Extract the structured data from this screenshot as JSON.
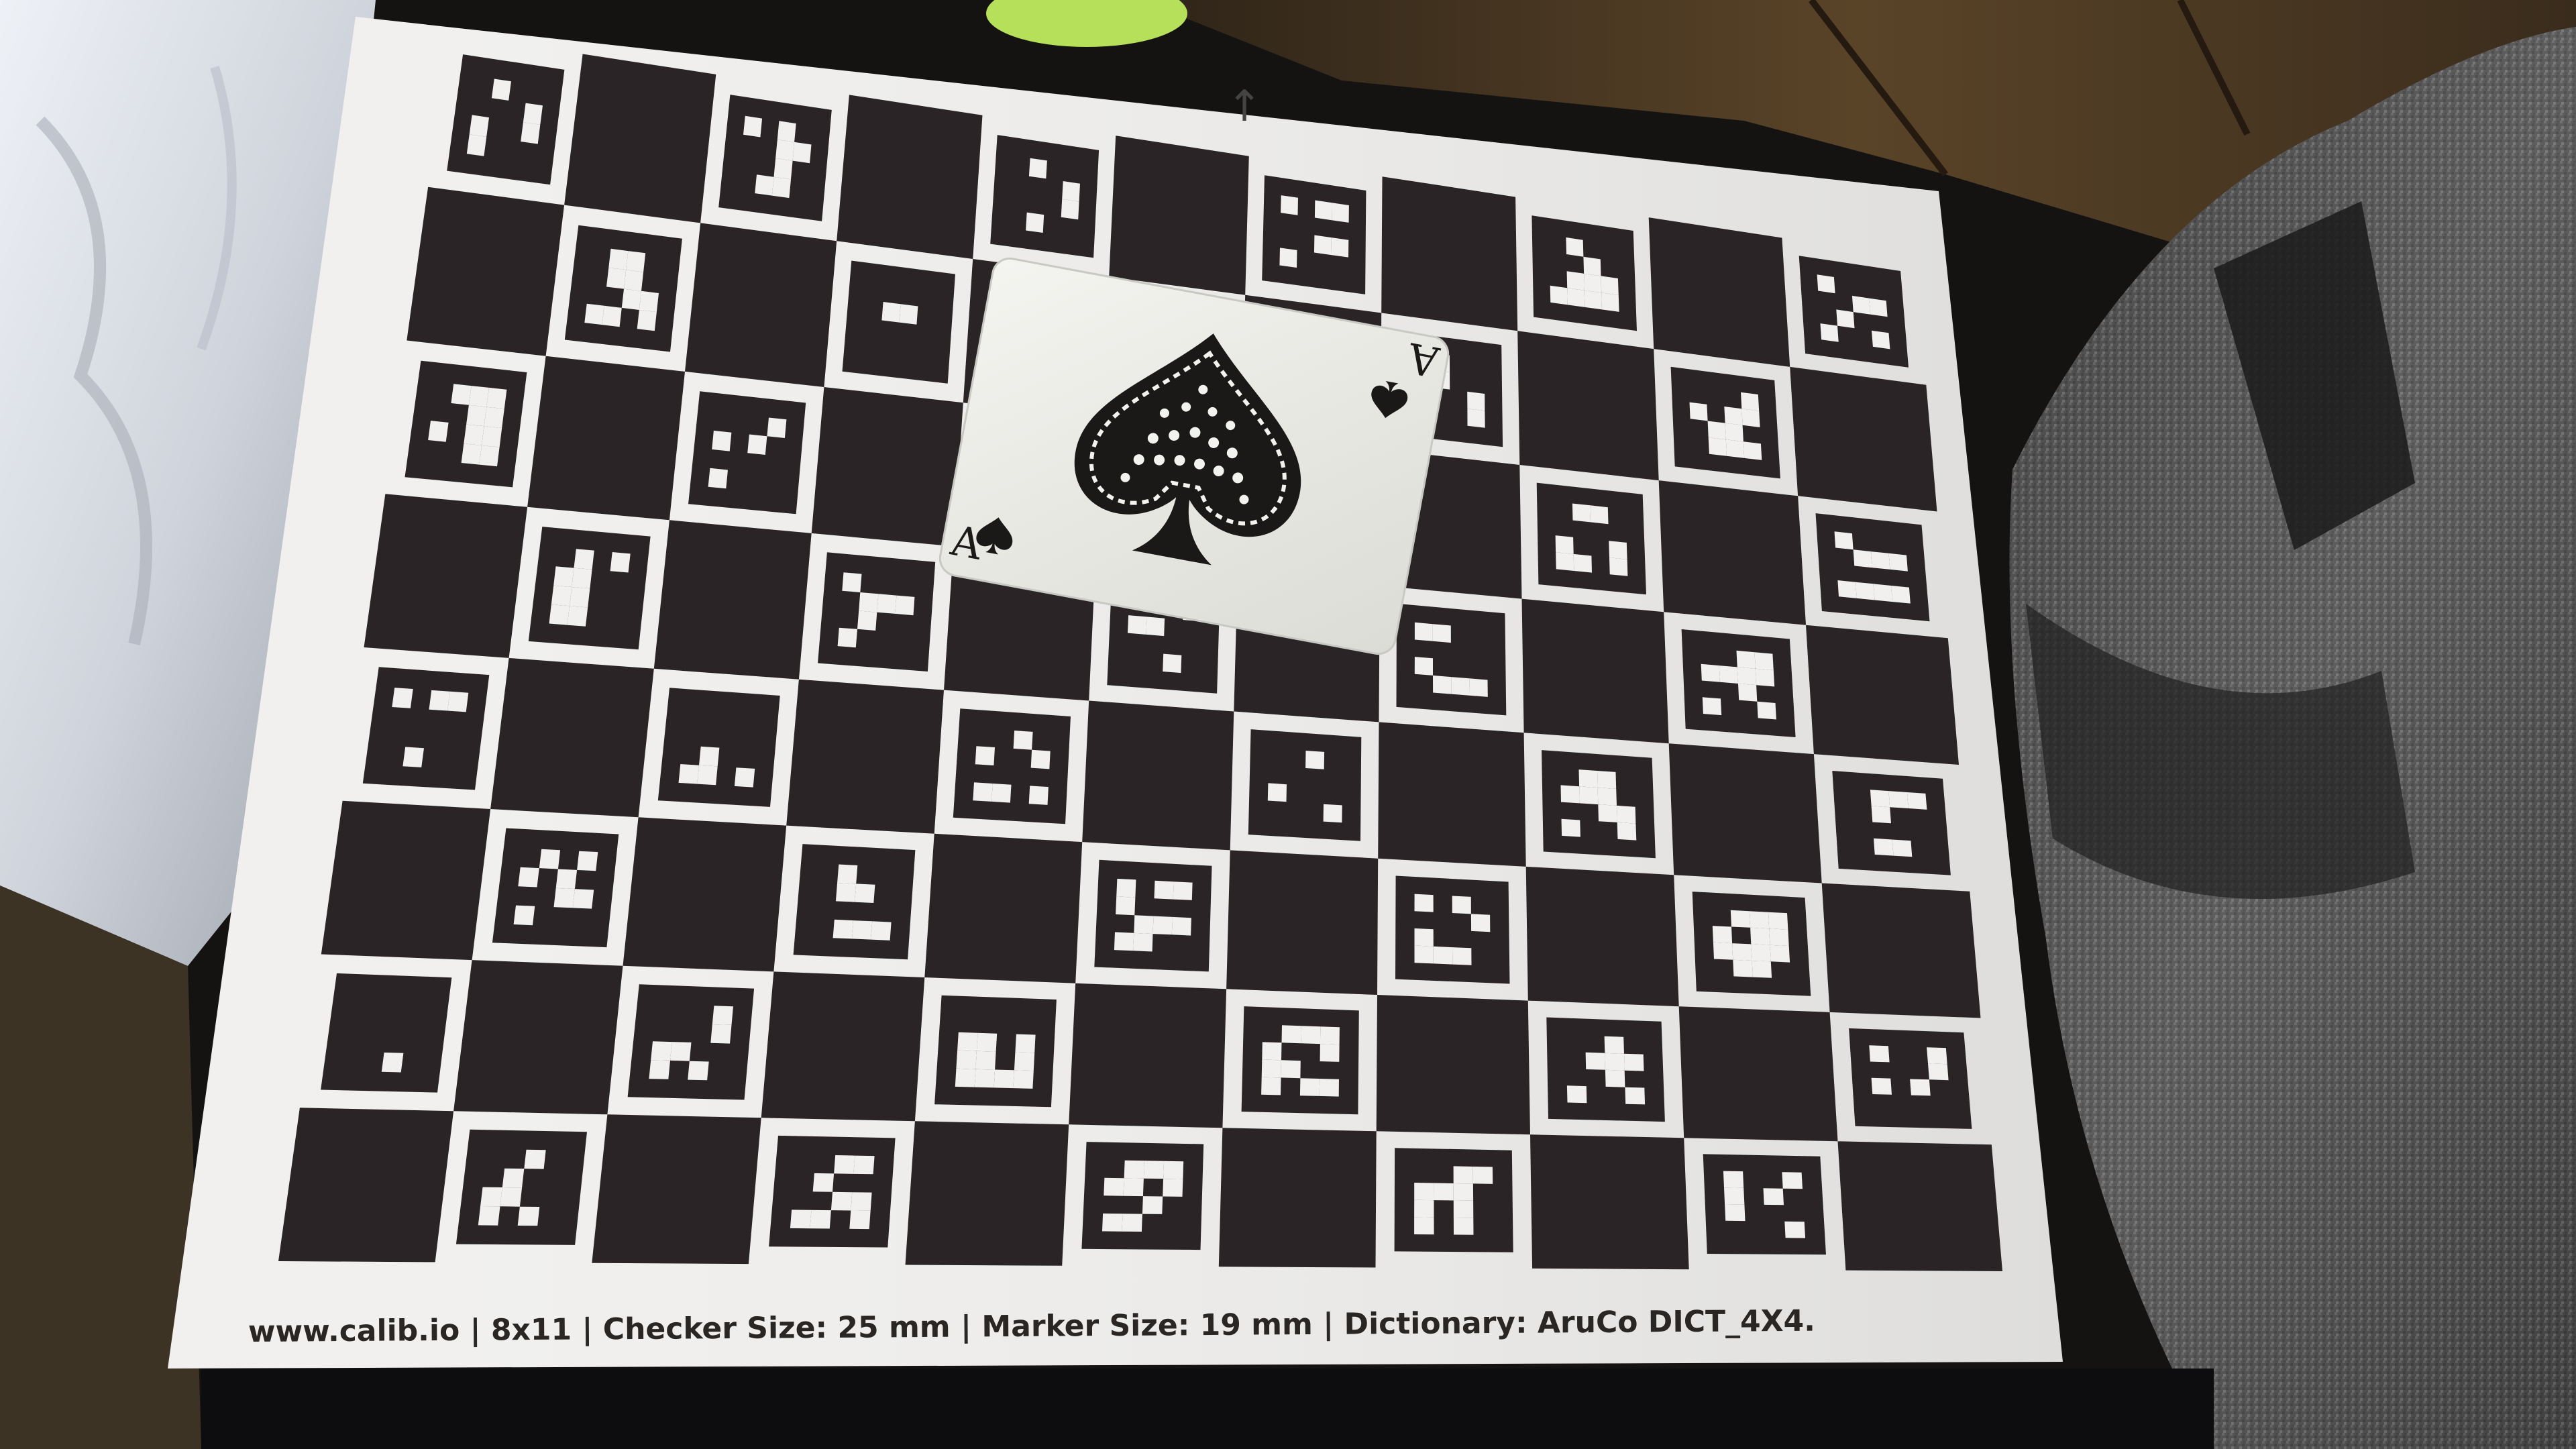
{
  "board": {
    "footer_text": "www.calib.io | 8x11 | Checker Size: 25 mm | Marker Size: 19 mm | Dictionary: AruCo DICT_4X4.",
    "rows": 8,
    "cols": 11,
    "orientation_mark": "↑"
  },
  "card": {
    "rank": "A",
    "suit": "spades"
  },
  "colors": {
    "board_paper": "#f1f0ee",
    "checker_black": "#2a2426",
    "cloth_white": "#dfe3ea",
    "backpack_grey": "#5a5a5a",
    "floor_brown": "#4a3a26"
  },
  "icons": [
    "spade-icon",
    "arrow-up-icon"
  ]
}
